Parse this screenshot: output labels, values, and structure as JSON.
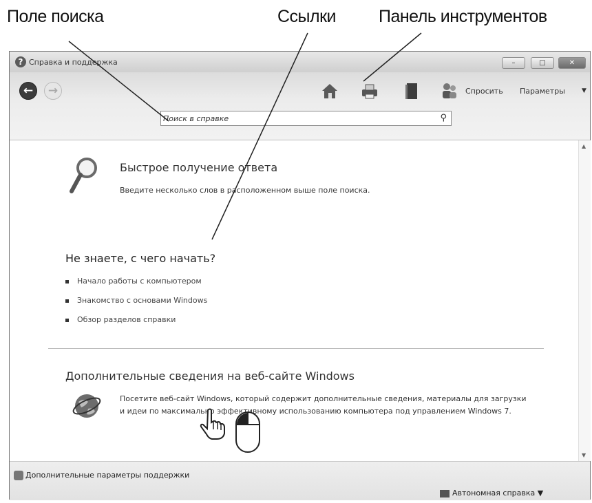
{
  "callouts": {
    "search_field": "Поле поиска",
    "links": "Ссылки",
    "toolbar": "Панель инструментов"
  },
  "window": {
    "title": "Справка и поддержка",
    "controls": {
      "minimize": "–",
      "maximize": "□",
      "close": "✕"
    }
  },
  "toolbar": {
    "back_icon": "arrow-left-icon",
    "forward_icon": "arrow-right-icon",
    "home_icon": "home-icon",
    "print_icon": "printer-icon",
    "browse_icon": "book-icon",
    "ask_icon": "people-icon",
    "ask_label": "Спросить",
    "options_label": "Параметры",
    "options_arrow": "▼"
  },
  "search": {
    "placeholder": "Поиск в справке",
    "icon": "search-icon"
  },
  "quick_answer": {
    "title": "Быстрое получение ответа",
    "description": "Введите несколько слов в расположенном выше поле поиска."
  },
  "getting_started": {
    "heading": "Не знаете, с чего начать?",
    "links": [
      "Начало работы с компьютером",
      "Знакомство с основами Windows",
      "Обзор разделов справки"
    ]
  },
  "web": {
    "heading": "Дополнительные сведения на веб-сайте Windows",
    "description": "Посетите веб-сайт Windows, который содержит дополнительные сведения, материалы для загрузки и идеи по максимально эффективному использованию компьютера под управлением Windows 7."
  },
  "status": {
    "more_support": "Дополнительные параметры поддержки",
    "offline_help": "Автономная справка",
    "offline_arrow": "▼"
  }
}
